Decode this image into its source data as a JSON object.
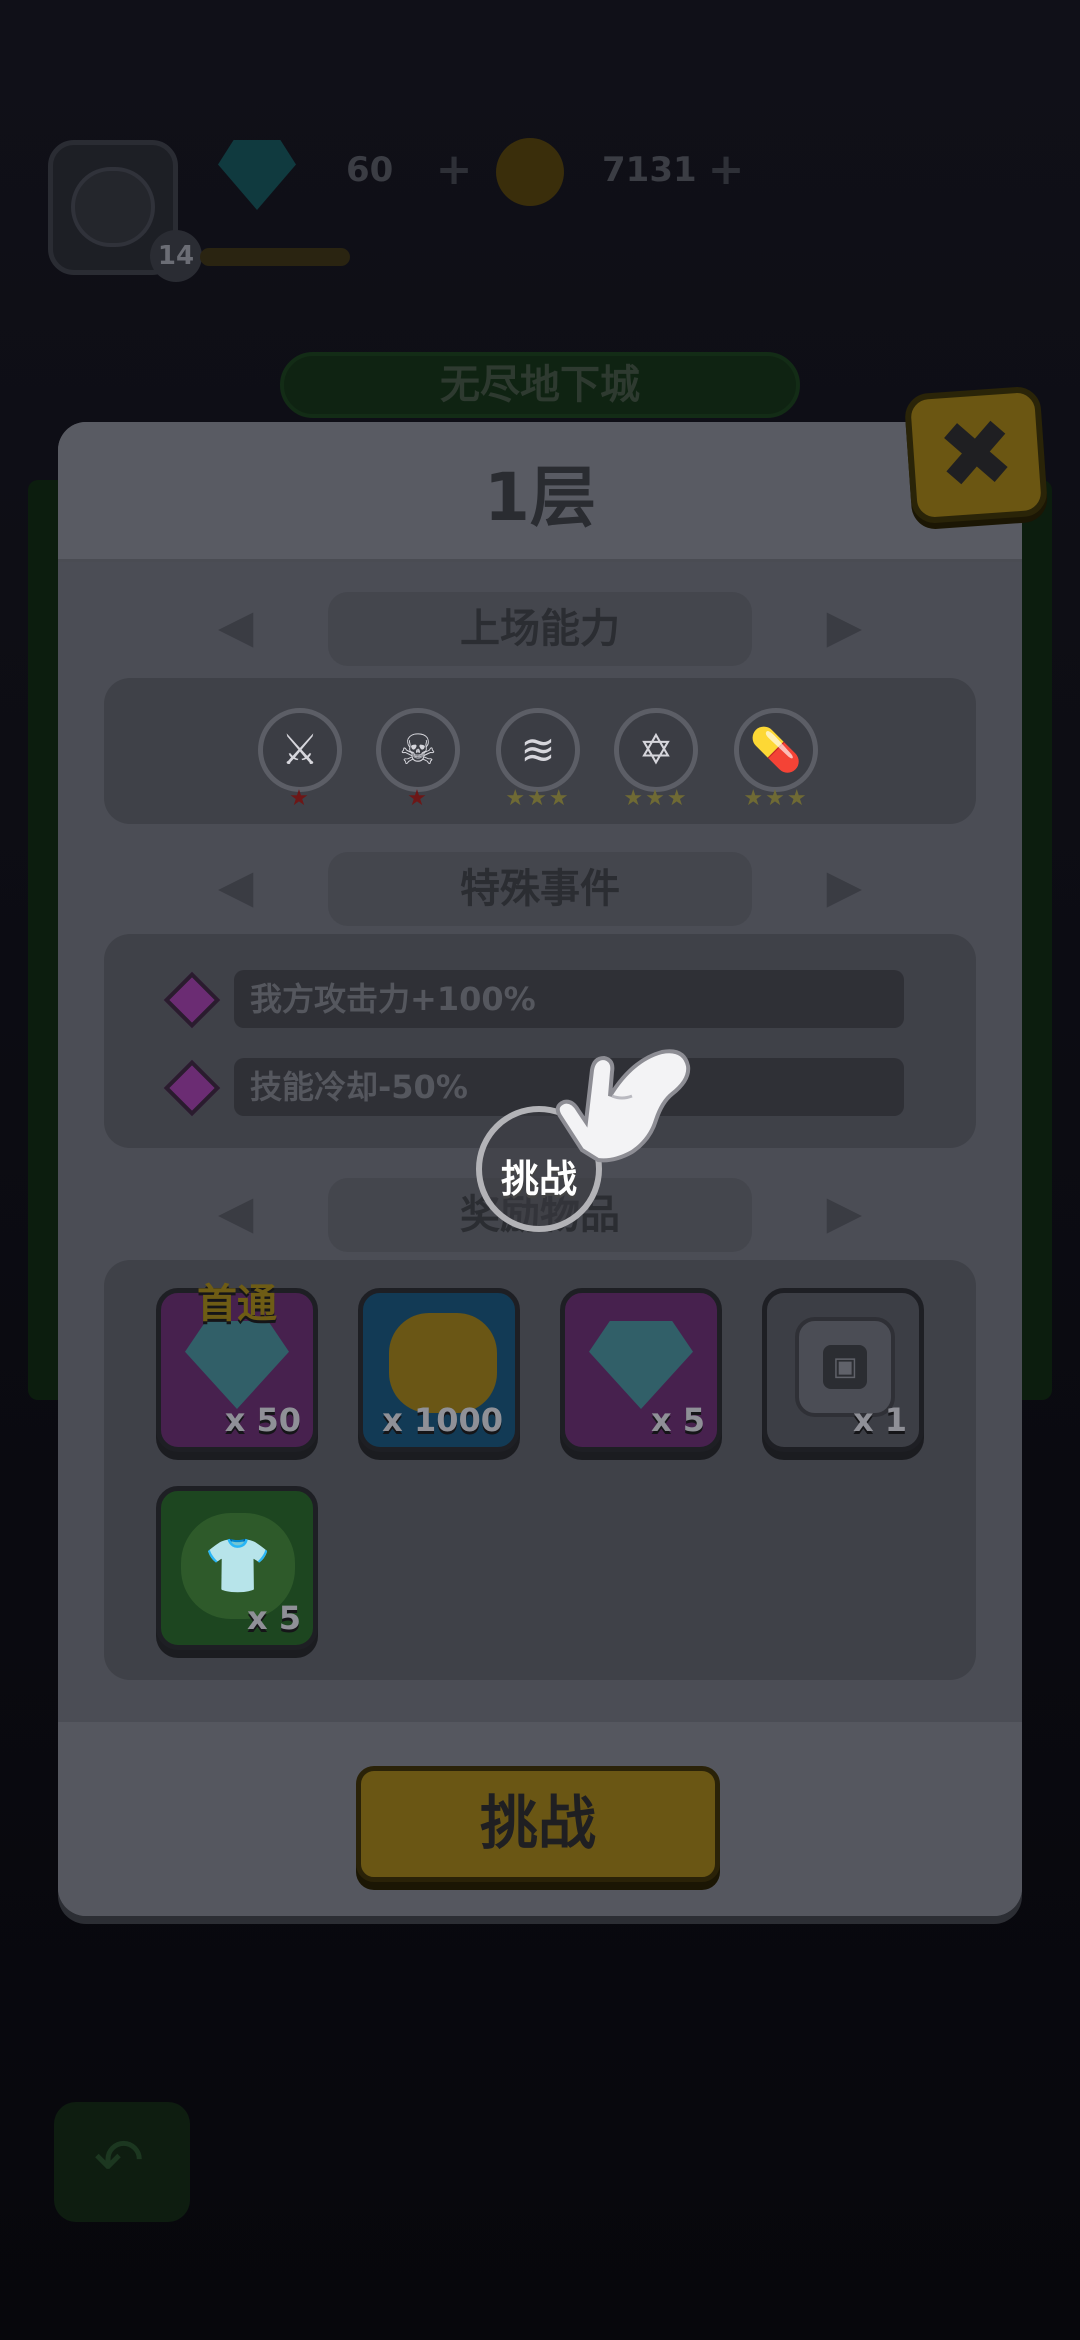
{
  "hud": {
    "gems": "60",
    "coins": "7131",
    "level": "14"
  },
  "dungeon_title": "无尽地下城",
  "popup": {
    "title": "1层",
    "sections": {
      "abilities": "上场能力",
      "events": "特殊事件",
      "rewards": "奖励物品"
    },
    "abilities": [
      {
        "icon": "sword-icon",
        "stars": "★",
        "star_color": "red"
      },
      {
        "icon": "skull-icon",
        "stars": "★",
        "star_color": "red"
      },
      {
        "icon": "tornado-icon",
        "stars": "★★★",
        "star_color": "gold"
      },
      {
        "icon": "star-badge-icon",
        "stars": "★★★",
        "star_color": "gold"
      },
      {
        "icon": "pill-icon",
        "stars": "★★★",
        "star_color": "gold"
      }
    ],
    "events": [
      "我方攻击力+100%",
      "技能冷却-50%"
    ],
    "rewards": [
      {
        "type": "gem",
        "qty": "x 50",
        "tag": "首通"
      },
      {
        "type": "coin",
        "qty": "x 1000"
      },
      {
        "type": "gem",
        "qty": "x 5"
      },
      {
        "type": "chip",
        "qty": "x 1"
      },
      {
        "type": "shirt",
        "qty": "x 5"
      }
    ],
    "challenge_button": "挑战"
  },
  "tutorial": {
    "focus_label": "挑战"
  },
  "colors": {
    "popup": "#55575f",
    "button": "#6a5614",
    "accent_purple": "#6b2c73"
  }
}
